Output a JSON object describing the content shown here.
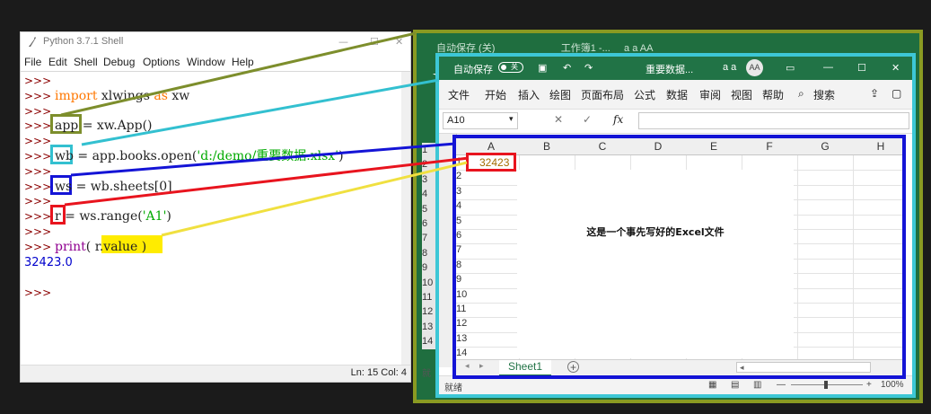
{
  "shell": {
    "title": "Python 3.7.1 Shell",
    "window_buttons": [
      "—",
      "☐",
      "✕"
    ],
    "menu": [
      "File",
      "Edit",
      "Shell",
      "Debug",
      "Options",
      "Window",
      "Help"
    ],
    "lines": {
      "l0": ">>>",
      "l1_prompt": ">>> ",
      "l1_import": "import",
      "l1_mid": " xlwings ",
      "l1_as": "as",
      "l1_end": " xw",
      "l2": ">>>",
      "l3_prompt": ">>> ",
      "l3_var": "app",
      "l3_rest": " = xw.App()",
      "l4": ">>>",
      "l5_prompt": ">>> ",
      "l5_var": "wb",
      "l5_rest": " = app.books.open(",
      "l5_str": "'d:/demo/重要数据.xlsx'",
      "l5_end": ")",
      "l6": ">>>",
      "l7_prompt": ">>> ",
      "l7_var": "ws",
      "l7_rest": " = wb.sheets[0]",
      "l8": ">>>",
      "l9_prompt": ">>> ",
      "l9_var": "r",
      "l9_rest": " = ws.range(",
      "l9_str": "'A1'",
      "l9_end": ")",
      "l10": ">>>",
      "l11_prompt": ">>> ",
      "l11_print": "print",
      "l11_open": "( ",
      "l11_val": "r.value",
      "l11_close": " )",
      "l12": "32423.0",
      "l13": "",
      "l14": ">>>"
    },
    "status": "Ln: 15  Col: 4"
  },
  "excel_back": {
    "autosave": "自动保存",
    "toggle": "关",
    "title": "工作簿1 -...",
    "user": "a a",
    "avatar": "AA",
    "file_tab": "文",
    "row_numbers": "1\n2\n3\n4\n5\n6\n7\n8\n9\n10\n11\n12\n13\n14",
    "status": "就"
  },
  "excel": {
    "autosave": "自动保存",
    "toggle": "关",
    "filename": "重要数据...",
    "user": "a a",
    "avatar": "AA",
    "ribbon_tabs": [
      "文件",
      "开始",
      "插入",
      "绘图",
      "页面布局",
      "公式",
      "数据",
      "审阅",
      "视图",
      "帮助",
      "搜索"
    ],
    "name_box": "A10",
    "fx": "fx",
    "columns": [
      "A",
      "B",
      "C",
      "D",
      "E",
      "F",
      "G",
      "H"
    ],
    "rows": [
      "1",
      "2",
      "3",
      "4",
      "5",
      "6",
      "7",
      "8",
      "9",
      "10",
      "11",
      "12",
      "13",
      "14"
    ],
    "cell_a1": "32423",
    "note": "这是一个事先写好的Excel文件",
    "sheet_tab": "Sheet1",
    "add_sheet": "+",
    "status_ready": "就绪",
    "zoom": "100%"
  },
  "colors": {
    "olive": "#8a9a22",
    "cyan": "#3dc7d6",
    "blue": "#1414d6",
    "red": "#e8141e",
    "yellow": "#ffec00",
    "excel_green": "#217346"
  }
}
